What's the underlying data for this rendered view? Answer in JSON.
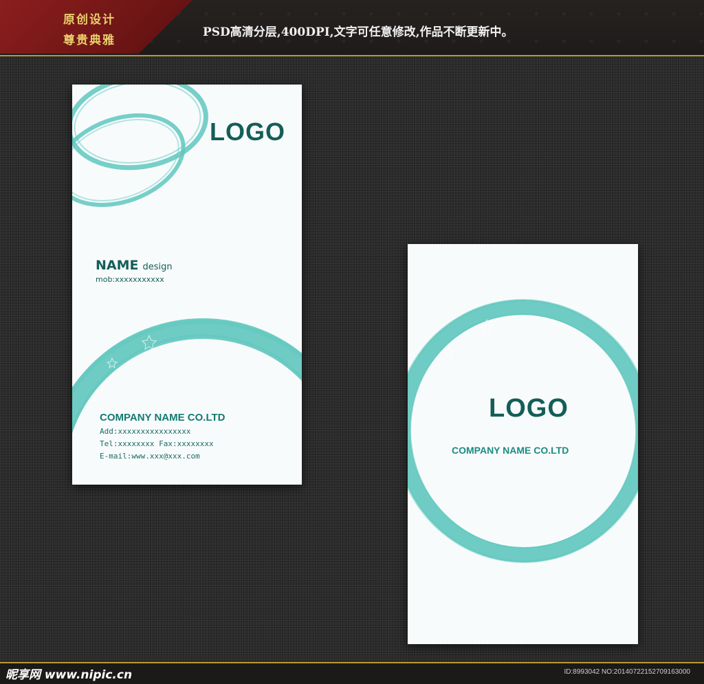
{
  "header": {
    "badge_line1": "原创设计",
    "badge_line2": "尊贵典雅",
    "slogan": "PSD高清分层,400DPI,文字可任意修改,作品不断更新中。"
  },
  "card_front": {
    "logo": "LOGO",
    "name": "NAME",
    "name_sub": "design",
    "mobile": "mob:xxxxxxxxxxx",
    "company": "COMPANY NAME CO.LTD",
    "address": "Add:xxxxxxxxxxxxxxxx",
    "tel_fax": "Tel:xxxxxxxx Fax:xxxxxxxx",
    "email": "E-mail:www.xxx@xxx.com"
  },
  "card_back": {
    "logo": "LOGO",
    "company": "COMPANY NAME CO.LTD"
  },
  "footer": {
    "site": "昵享网 www.nipic.cn",
    "image_id": "ID:8993042 NO:20140722152709163000"
  },
  "colors": {
    "accent_teal": "#5fc7be",
    "text_teal": "#145e58",
    "badge_red": "#8c1e1e",
    "gold": "#e9cf6b"
  }
}
